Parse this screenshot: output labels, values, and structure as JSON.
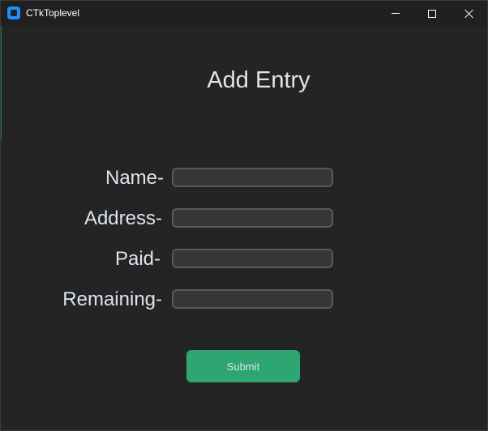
{
  "window": {
    "title": "CTkToplevel"
  },
  "form": {
    "heading": "Add Entry",
    "fields": [
      {
        "label": "Name-",
        "value": ""
      },
      {
        "label": "Address-",
        "value": ""
      },
      {
        "label": "Paid-",
        "value": ""
      },
      {
        "label": "Remaining-",
        "value": ""
      }
    ],
    "submit_label": "Submit"
  },
  "icons": {
    "app": "app-icon",
    "minimize": "minimize-icon",
    "maximize": "maximize-icon",
    "close": "close-icon"
  },
  "colors": {
    "background": "#242424",
    "titlebar": "#202020",
    "text": "#dce4ee",
    "entry_bg": "#343638",
    "entry_border": "#565b5e",
    "button": "#2fa572",
    "app_icon": "#1e8fff"
  }
}
